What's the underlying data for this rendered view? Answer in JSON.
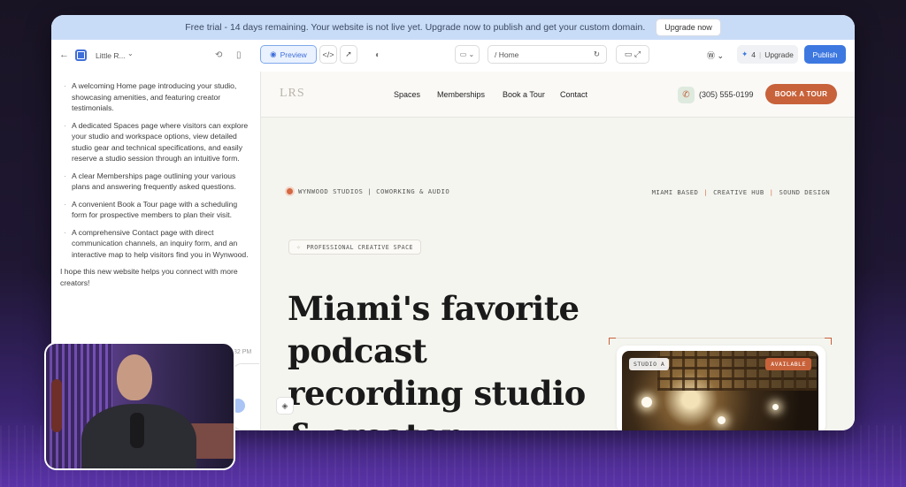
{
  "trial_bar": {
    "message": "Free trial - 14 days remaining. Your website is not live yet. Upgrade now to publish and get your custom domain.",
    "upgrade_label": "Upgrade now"
  },
  "toolbar": {
    "project_name": "Little R...",
    "preview_label": "Preview",
    "url_path": "/ Home",
    "credits": "4",
    "upgrade_label": "Upgrade",
    "publish_label": "Publish"
  },
  "chat": {
    "items": [
      "A welcoming Home page introducing your studio, showcasing amenities, and featuring creator testimonials.",
      "A dedicated Spaces page where visitors can explore your studio and workspace options, view detailed studio gear and technical specifications, and easily reserve a studio session through an intuitive form.",
      "A clear Memberships page outlining your various plans and answering frequently asked questions.",
      "A convenient Book a Tour page with a scheduling form for prospective members to plan their visit.",
      "A comprehensive Contact page with direct communication channels, an inquiry form, and an interactive map to help visitors find you in Wynwood."
    ],
    "closing": "I hope this new website helps you connect with more creators!",
    "time_fragment": "32 PM"
  },
  "site": {
    "logo": "LRS",
    "nav": [
      "Spaces",
      "Memberships",
      "Book a Tour",
      "Contact"
    ],
    "phone": "(305) 555-0199",
    "cta": "BOOK A TOUR",
    "strip_left": "WYNWOOD STUDIOS | COWORKING & AUDIO",
    "strip_right": [
      "MIAMI BASED",
      "CREATIVE HUB",
      "SOUND DESIGN"
    ],
    "strip_sep": "|",
    "badge": "PROFESSIONAL CREATIVE SPACE",
    "headline": "Miami's favorite podcast recording studio & creator",
    "card_tag": "STUDIO A",
    "card_status": "AVAILABLE"
  },
  "colors": {
    "accent": "#c8623a",
    "publish": "#3d78e0",
    "trial_bar": "#c9dcf7"
  }
}
